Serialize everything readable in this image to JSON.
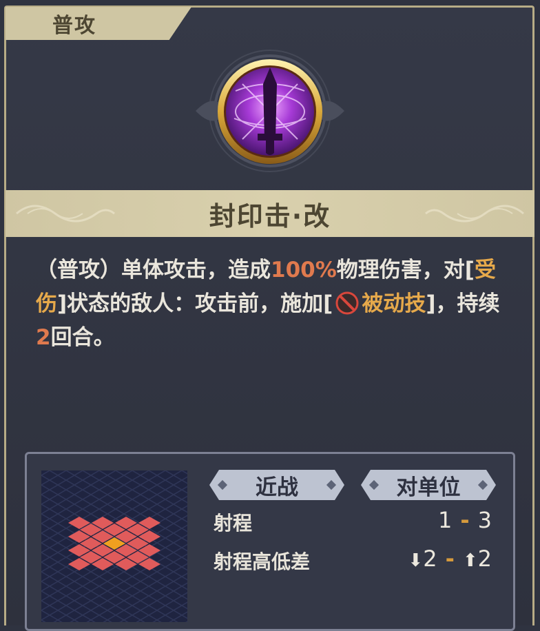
{
  "tab": {
    "label": "普攻"
  },
  "skill": {
    "name": "封印击·改",
    "icon": "purple-sword-seal-icon"
  },
  "description": {
    "p1": "（普攻）单体攻击，造成",
    "pct": "100%",
    "p2": "物理伤害，对[",
    "status": "受伤",
    "p3": "]状态的敌人：攻击前，施加[",
    "effect_icon": "no-entry-icon",
    "effect": "被动技",
    "p4": "]，持续",
    "turns": "2",
    "p5": "回合。"
  },
  "attack": {
    "type_label": "近战",
    "target_label": "对单位",
    "range_label": "射程",
    "range_min": "1",
    "range_max": "3",
    "height_label": "射程高低差",
    "height_down": "2",
    "height_up": "2",
    "separator": "-"
  },
  "colors": {
    "highlight_orange": "#e07a4e",
    "highlight_gold": "#e6a94b",
    "range_tile": "#e05b5b",
    "origin_tile": "#f0a020"
  }
}
